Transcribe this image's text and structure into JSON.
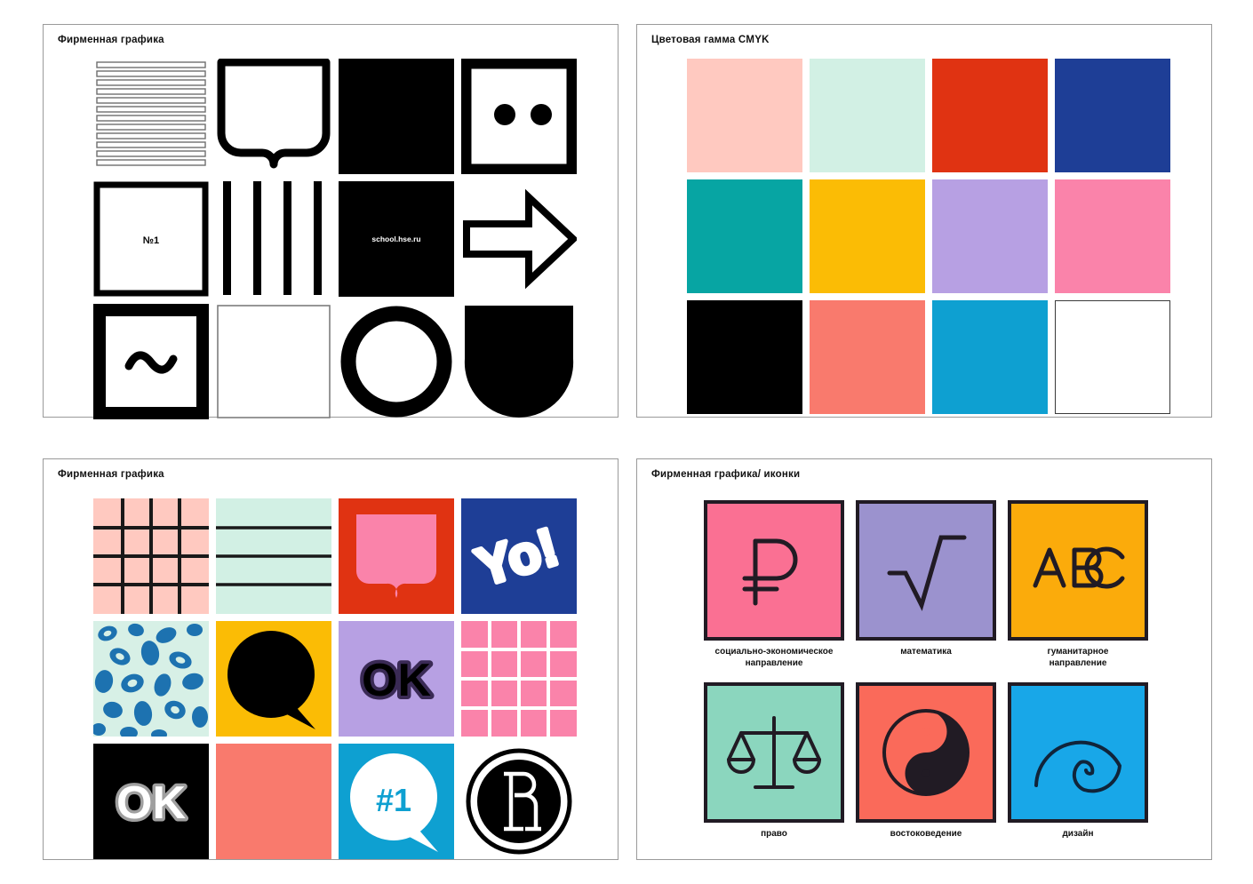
{
  "panels": [
    {
      "title": "Фирменная графика"
    },
    {
      "title": "Цветовая гамма CMYK"
    },
    {
      "title": "Фирменная графика"
    },
    {
      "title": "Фирменная графика/ иконки"
    }
  ],
  "mono_graphics": {
    "tiles": [
      {
        "name": "horizontal-stripes-tile",
        "kind": "stripes-horizontal",
        "bars": 12
      },
      {
        "name": "shield-outline-tile",
        "kind": "shield-outline"
      },
      {
        "name": "solid-black-square-tile",
        "kind": "solid-black"
      },
      {
        "name": "two-dots-frame-tile",
        "kind": "two-dots-frame"
      },
      {
        "name": "number-one-square-tile",
        "kind": "label-square",
        "text": "№1"
      },
      {
        "name": "vertical-stripes-tile",
        "kind": "stripes-vertical",
        "bars": 4
      },
      {
        "name": "url-black-square-tile",
        "kind": "url-square",
        "text": "school.hse.ru"
      },
      {
        "name": "arrow-outline-tile",
        "kind": "arrow-outline"
      },
      {
        "name": "tilde-frame-tile",
        "kind": "tilde-frame"
      },
      {
        "name": "empty-square-tile",
        "kind": "empty-square"
      },
      {
        "name": "ring-circle-tile",
        "kind": "ring-circle"
      },
      {
        "name": "shield-solid-tile",
        "kind": "shield-solid"
      }
    ]
  },
  "cmyk_palette": {
    "swatches": [
      {
        "name": "swatch-blush-pink",
        "hex": "#FFC9C0"
      },
      {
        "name": "swatch-mint",
        "hex": "#D2F0E4"
      },
      {
        "name": "swatch-red-orange",
        "hex": "#E03312"
      },
      {
        "name": "swatch-royal-blue",
        "hex": "#1E3E96"
      },
      {
        "name": "swatch-teal",
        "hex": "#07A5A3"
      },
      {
        "name": "swatch-amber",
        "hex": "#FBBC05"
      },
      {
        "name": "swatch-lavender",
        "hex": "#B7A0E3"
      },
      {
        "name": "swatch-hot-pink",
        "hex": "#FA83AA"
      },
      {
        "name": "swatch-black",
        "hex": "#000000"
      },
      {
        "name": "swatch-salmon",
        "hex": "#F97A6D"
      },
      {
        "name": "swatch-sky-blue",
        "hex": "#0EA0D1"
      },
      {
        "name": "swatch-white",
        "hex": "#FFFFFF",
        "bordered": true
      }
    ]
  },
  "pattern_graphics": {
    "tiles": [
      {
        "name": "pink-checker-grid-tile",
        "kind": "checker-grid",
        "bg": "#FFC9C0",
        "line": "#191919"
      },
      {
        "name": "mint-rules-tile",
        "kind": "horizontal-rules",
        "bg": "#D2F0E4",
        "line": "#191919"
      },
      {
        "name": "pink-shield-on-red-tile",
        "kind": "shield-fill",
        "bg": "#E03312",
        "fg": "#FA83AA"
      },
      {
        "name": "yo-exclaim-tile",
        "kind": "yo-text",
        "bg": "#1E3E96",
        "fg": "#FFFFFF",
        "text": "Yo!"
      },
      {
        "name": "leopard-print-tile",
        "kind": "leopard",
        "bg": "#D7F0E6",
        "fg": "#1D72B0"
      },
      {
        "name": "speech-bubble-tile",
        "kind": "speech-bubble",
        "bg": "#FBBC05",
        "fg": "#000000"
      },
      {
        "name": "ok-outline-lavender-tile",
        "kind": "ok-outline",
        "bg": "#B7A0E3",
        "fg": "#000000",
        "text": "OK"
      },
      {
        "name": "pink-tile-grid-tile",
        "kind": "tile-grid",
        "bg": "#FA83AA",
        "line": "#FFFFFF"
      },
      {
        "name": "ok-white-on-black-tile",
        "kind": "ok-solid",
        "bg": "#000000",
        "fg": "#FFFFFF",
        "text": "OK"
      },
      {
        "name": "solid-salmon-tile",
        "kind": "solid",
        "bg": "#F97A6D"
      },
      {
        "name": "hashtag-one-bubble-tile",
        "kind": "bubble-number",
        "bg": "#0EA0D1",
        "fg": "#FFFFFF",
        "text": "#1"
      },
      {
        "name": "hse-monogram-tile",
        "kind": "hse-logo",
        "bg": "#FFFFFF",
        "fg": "#000000"
      }
    ]
  },
  "subject_icons": {
    "items": [
      {
        "name": "icon-social-economics",
        "glyph": "ruble-sign",
        "bg": "#FA7093",
        "stroke": "#211b24",
        "label": "социально-экономическое\nнаправление"
      },
      {
        "name": "icon-mathematics",
        "glyph": "square-root",
        "bg": "#9B92CE",
        "stroke": "#211b24",
        "label": "математика"
      },
      {
        "name": "icon-humanities",
        "glyph": "abc-letters",
        "bg": "#FBAB0B",
        "stroke": "#211b24",
        "label": "гуманитарное\nнаправление"
      },
      {
        "name": "icon-law",
        "glyph": "balance-scales",
        "bg": "#8BD6BE",
        "stroke": "#211b24",
        "label": "право"
      },
      {
        "name": "icon-oriental-studies",
        "glyph": "yin-yang",
        "bg": "#FA6A5A",
        "stroke": "#211b24",
        "label": "востоковедение"
      },
      {
        "name": "icon-design",
        "glyph": "spiral",
        "bg": "#18A7E8",
        "stroke": "#10243a",
        "label": "дизайн"
      }
    ]
  }
}
